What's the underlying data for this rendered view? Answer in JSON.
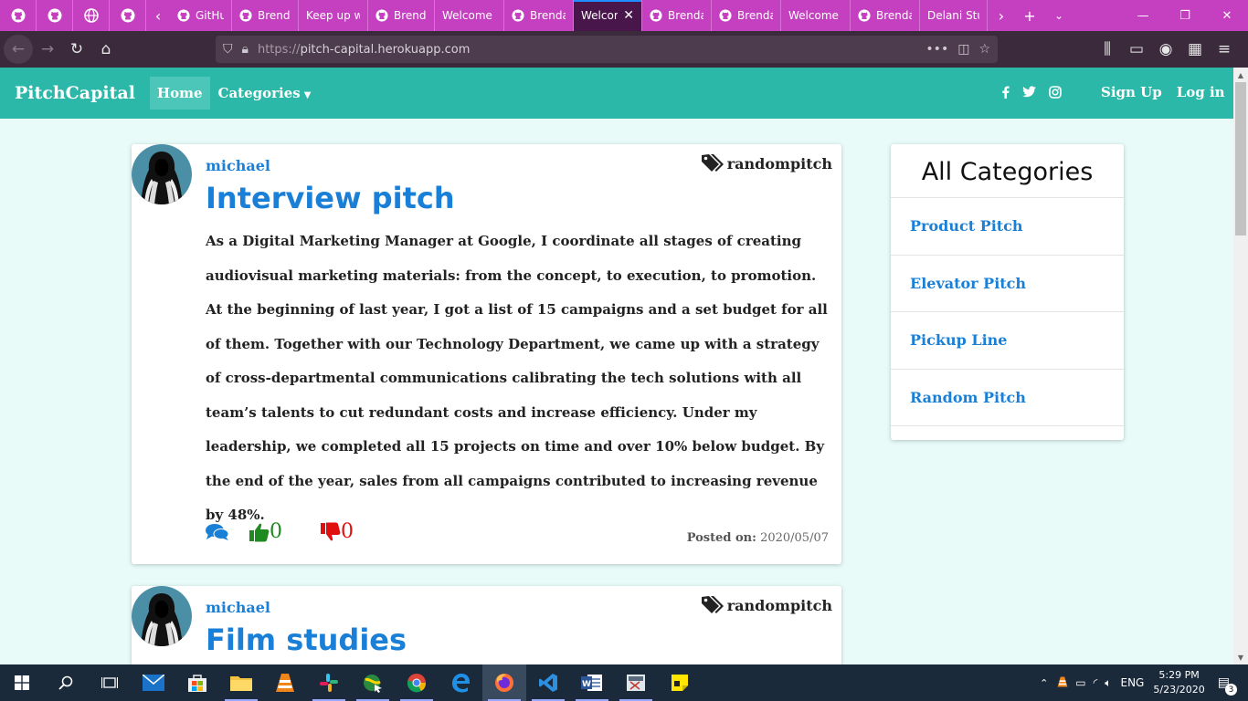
{
  "browser": {
    "pinned_tabs": [
      {
        "icon": "github-icon"
      },
      {
        "icon": "github-icon"
      },
      {
        "icon": "globe-icon"
      },
      {
        "icon": "github-icon"
      }
    ],
    "tabs": [
      {
        "title": "GitHub",
        "icon": "github-icon",
        "active": false
      },
      {
        "title": "Brenda",
        "icon": "github-icon",
        "active": false
      },
      {
        "title": "Keep up w",
        "icon": "",
        "active": false
      },
      {
        "title": "Brenda",
        "icon": "github-icon",
        "active": false
      },
      {
        "title": "Welcome t",
        "icon": "",
        "active": false
      },
      {
        "title": "Brenda",
        "icon": "github-icon",
        "active": false
      },
      {
        "title": "Welcome",
        "icon": "",
        "active": true
      },
      {
        "title": "Brenda",
        "icon": "github-icon",
        "active": false
      },
      {
        "title": "Brenda",
        "icon": "github-icon",
        "active": false
      },
      {
        "title": "Welcome t",
        "icon": "",
        "active": false
      },
      {
        "title": "Brenda",
        "icon": "github-icon",
        "active": false
      },
      {
        "title": "Delani Stu",
        "icon": "",
        "active": false
      }
    ],
    "url": "https://pitch-capital.herokuapp.com",
    "url_dim_prefix": "https://",
    "url_host": "pitch-capital.herokuapp.com",
    "accent_color": "#c540c0"
  },
  "site": {
    "brand": "PitchCapital",
    "nav_home": "Home",
    "nav_categories": "Categories",
    "sign_up": "Sign Up",
    "log_in": "Log in",
    "header_color": "#2bb8a8"
  },
  "posts": [
    {
      "author": "michael",
      "category": "randompitch",
      "title": "Interview pitch",
      "body": "As a Digital Marketing Manager at Google, I coordinate all stages of creating audiovisual marketing materials: from the concept, to execution, to promotion. At the beginning of last year, I got a list of 15 campaigns and a set budget for all of them. Together with our Technology Department, we came up with a strategy of cross-departmental communications calibrating the tech solutions with all team’s talents to cut redundant costs and increase efficiency. Under my leadership, we completed all 15 projects on time and over 10% below budget. By the end of the year, sales from all campaigns contributed to increasing revenue by 48%.",
      "upvotes": "0",
      "downvotes": "0",
      "posted_label": "Posted on:",
      "posted_date": "2020/05/07"
    },
    {
      "author": "michael",
      "category": "randompitch",
      "title": "Film studies"
    }
  ],
  "sidebar": {
    "title": "All Categories",
    "items": [
      "Product Pitch",
      "Elevator Pitch",
      "Pickup Line",
      "Random Pitch"
    ]
  },
  "taskbar": {
    "time": "5:29 PM",
    "date": "5/23/2020",
    "language": "ENG",
    "notifications": "3"
  }
}
